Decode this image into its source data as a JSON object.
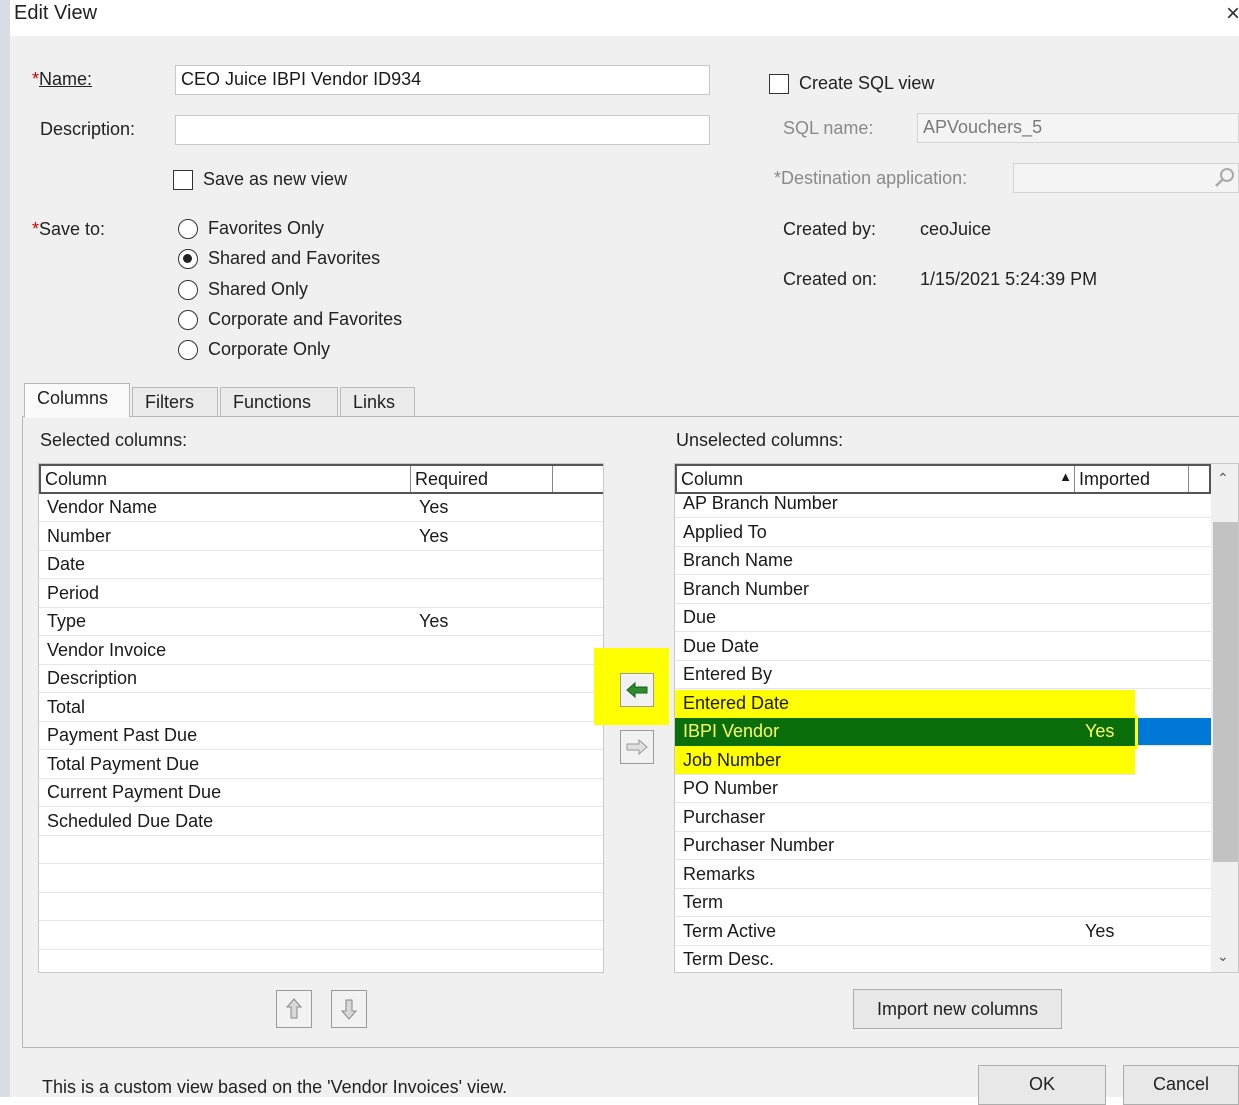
{
  "window": {
    "title": "Edit View",
    "close_glyph": "×"
  },
  "form": {
    "name_label": "Name:",
    "name_value": "CEO Juice IBPI Vendor ID934",
    "description_label": "Description:",
    "description_value": "",
    "save_as_new_label": "Save as new view",
    "save_to_label": "Save to:",
    "required_marker": "*",
    "save_to_options": [
      {
        "label": "Favorites Only",
        "selected": false
      },
      {
        "label": "Shared and Favorites",
        "selected": true
      },
      {
        "label": "Shared Only",
        "selected": false
      },
      {
        "label": "Corporate and Favorites",
        "selected": false
      },
      {
        "label": "Corporate Only",
        "selected": false
      }
    ],
    "create_sql_label": "Create SQL view",
    "sql_name_label": "SQL name:",
    "sql_name_value": "APVouchers_5",
    "destination_label": "Destination application:",
    "destination_value": "",
    "created_by_label": "Created by:",
    "created_by_value": "ceoJuice",
    "created_on_label": "Created on:",
    "created_on_value": "1/15/2021 5:24:39 PM"
  },
  "tabs": [
    "Columns",
    "Filters",
    "Functions",
    "Links"
  ],
  "selected": {
    "title": "Selected columns:",
    "headers": [
      "Column",
      "Required"
    ],
    "rows": [
      [
        "Vendor Name",
        "Yes"
      ],
      [
        "Number",
        "Yes"
      ],
      [
        "Date",
        ""
      ],
      [
        "Period",
        ""
      ],
      [
        "Type",
        "Yes"
      ],
      [
        "Vendor Invoice",
        ""
      ],
      [
        "Description",
        ""
      ],
      [
        "Total",
        ""
      ],
      [
        "Payment Past Due",
        ""
      ],
      [
        "Total Payment Due",
        ""
      ],
      [
        "Current Payment Due",
        ""
      ],
      [
        "Scheduled Due Date",
        ""
      ]
    ]
  },
  "unselected": {
    "title": "Unselected columns:",
    "headers": [
      "Column",
      "Imported"
    ],
    "sort_glyph": "▲",
    "rows": [
      [
        "AP Branch Number",
        ""
      ],
      [
        "Applied To",
        ""
      ],
      [
        "Branch Name",
        ""
      ],
      [
        "Branch Number",
        ""
      ],
      [
        "Due",
        ""
      ],
      [
        "Due Date",
        ""
      ],
      [
        "Entered By",
        ""
      ],
      [
        "Entered Date",
        ""
      ],
      [
        "IBPI Vendor",
        "Yes"
      ],
      [
        "Job Number",
        ""
      ],
      [
        "PO Number",
        ""
      ],
      [
        "Purchaser",
        ""
      ],
      [
        "Purchaser Number",
        ""
      ],
      [
        "Remarks",
        ""
      ],
      [
        "Term",
        ""
      ],
      [
        "Term Active",
        "Yes"
      ],
      [
        "Term Desc.",
        ""
      ]
    ],
    "selected_row": "IBPI Vendor"
  },
  "buttons": {
    "import_label": "Import new columns",
    "ok_label": "OK",
    "cancel_label": "Cancel"
  },
  "footer_text": "This is a custom view based on the 'Vendor Invoices' view.",
  "colors": {
    "highlight": "#ffff00",
    "selection_green": "#0a6e0a",
    "selection_blue": "#0078d7",
    "arrow_green": "#2e8b2e"
  }
}
